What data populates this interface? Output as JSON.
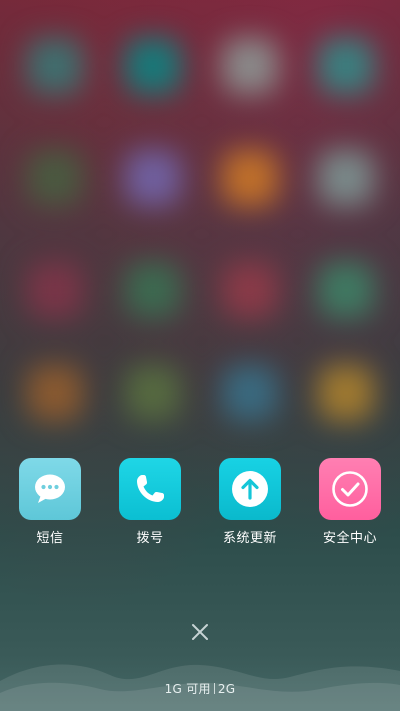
{
  "dock": {
    "apps": [
      {
        "label": "短信",
        "icon": "message-bubble-icon",
        "color_top": "#7fd9e8",
        "color_bottom": "#5ec7d8"
      },
      {
        "label": "拨号",
        "icon": "phone-icon",
        "color_top": "#1fd6e6",
        "color_bottom": "#0bbfd2"
      },
      {
        "label": "系统更新",
        "icon": "upload-arrow-icon",
        "color_top": "#18d2e4",
        "color_bottom": "#0ab9cc"
      },
      {
        "label": "安全中心",
        "icon": "checkmark-icon",
        "color_top": "#ff7fb2",
        "color_bottom": "#ff5f9e"
      }
    ]
  },
  "memory": {
    "available": "1G 可用",
    "total": "2G"
  },
  "close": {
    "icon": "close-icon"
  }
}
